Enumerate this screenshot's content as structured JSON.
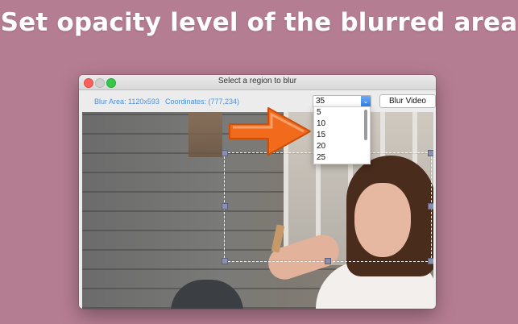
{
  "headline": "Set opacity level of the blurred area",
  "window": {
    "title": "Select a region to blur",
    "blur_area": "Blur Area: 1120x593",
    "coordinates": "Coordinates: (777,234)",
    "opacity_select": {
      "value": "35",
      "options": [
        "5",
        "10",
        "15",
        "20",
        "25"
      ]
    },
    "blur_video_button": "Blur Video"
  },
  "colors": {
    "background": "#b57d91",
    "info_text": "#4a90e2",
    "arrow": "#f26a1b"
  }
}
